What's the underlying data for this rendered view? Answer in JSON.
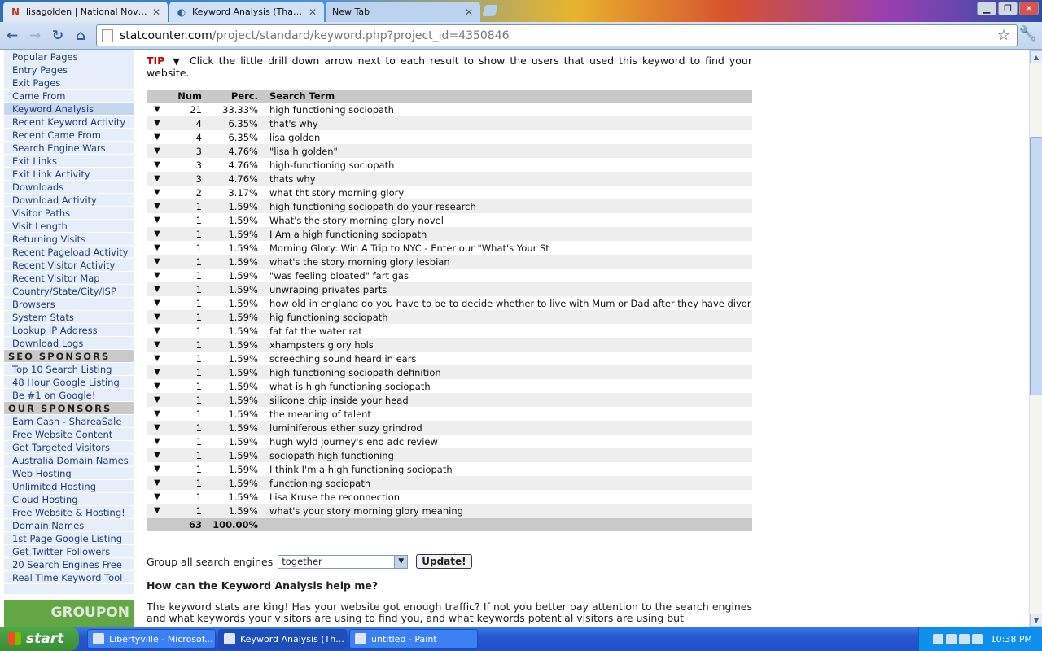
{
  "browser": {
    "tabs": [
      {
        "label": "lisagolden | National Novel ...",
        "icon": "N"
      },
      {
        "label": "Keyword Analysis (That's ...",
        "icon": "◐"
      },
      {
        "label": "New Tab",
        "icon": ""
      }
    ],
    "url_host": "statcounter.com",
    "url_path": "/project/standard/keyword.php?project_id=4350846"
  },
  "sidebar": {
    "items": [
      {
        "label": "Popular Pages",
        "type": "link"
      },
      {
        "label": "Entry Pages",
        "type": "link"
      },
      {
        "label": "Exit Pages",
        "type": "link"
      },
      {
        "label": "Came From",
        "type": "link"
      },
      {
        "label": "Keyword Analysis",
        "type": "link",
        "active": true
      },
      {
        "label": "Recent Keyword Activity",
        "type": "link"
      },
      {
        "label": "Recent Came From",
        "type": "link"
      },
      {
        "label": "Search Engine Wars",
        "type": "link"
      },
      {
        "label": "Exit Links",
        "type": "link"
      },
      {
        "label": "Exit Link Activity",
        "type": "link"
      },
      {
        "label": "Downloads",
        "type": "link"
      },
      {
        "label": "Download Activity",
        "type": "link"
      },
      {
        "label": "Visitor Paths",
        "type": "link"
      },
      {
        "label": "Visit Length",
        "type": "link"
      },
      {
        "label": "Returning Visits",
        "type": "link"
      },
      {
        "label": "Recent Pageload Activity",
        "type": "link"
      },
      {
        "label": "Recent Visitor Activity",
        "type": "link"
      },
      {
        "label": "Recent Visitor Map",
        "type": "link"
      },
      {
        "label": "Country/State/City/ISP",
        "type": "link"
      },
      {
        "label": "Browsers",
        "type": "link"
      },
      {
        "label": "System Stats",
        "type": "link"
      },
      {
        "label": "Lookup IP Address",
        "type": "link"
      },
      {
        "label": "Download Logs",
        "type": "link"
      },
      {
        "label": "SEO SPONSORS",
        "type": "heading"
      },
      {
        "label": "Top 10 Search Listing",
        "type": "link"
      },
      {
        "label": "48 Hour Google Listing",
        "type": "link"
      },
      {
        "label": "Be #1 on Google!",
        "type": "link"
      },
      {
        "label": "OUR SPONSORS",
        "type": "heading"
      },
      {
        "label": "Earn Cash - ShareaSale",
        "type": "link"
      },
      {
        "label": "Free Website Content",
        "type": "link"
      },
      {
        "label": "Get Targeted Visitors",
        "type": "link"
      },
      {
        "label": "Australia Domain Names",
        "type": "link"
      },
      {
        "label": "Web Hosting",
        "type": "link"
      },
      {
        "label": "Unlimited Hosting",
        "type": "link"
      },
      {
        "label": "Cloud Hosting",
        "type": "link"
      },
      {
        "label": "Free Website & Hosting!",
        "type": "link"
      },
      {
        "label": "Domain Names",
        "type": "link"
      },
      {
        "label": "1st Page Google Listing",
        "type": "link"
      },
      {
        "label": "Get Twitter Followers",
        "type": "link"
      },
      {
        "label": "20 Search Engines Free",
        "type": "link"
      },
      {
        "label": "Real Time Keyword Tool",
        "type": "link"
      }
    ],
    "banner": "GROUPON"
  },
  "main": {
    "tip_label": "TIP",
    "tip_text": "Click the little drill down arrow next to each result to show the users that used this keyword to find your website.",
    "table": {
      "headers": {
        "num": "Num",
        "perc": "Perc.",
        "term": "Search Term"
      },
      "rows": [
        {
          "num": "21",
          "perc": "33.33%",
          "term": "high functioning sociopath"
        },
        {
          "num": "4",
          "perc": "6.35%",
          "term": "that's why"
        },
        {
          "num": "4",
          "perc": "6.35%",
          "term": "lisa golden"
        },
        {
          "num": "3",
          "perc": "4.76%",
          "term": "\"lisa h golden\""
        },
        {
          "num": "3",
          "perc": "4.76%",
          "term": "high-functioning sociopath"
        },
        {
          "num": "3",
          "perc": "4.76%",
          "term": "thats why"
        },
        {
          "num": "2",
          "perc": "3.17%",
          "term": "what tht story morning glory"
        },
        {
          "num": "1",
          "perc": "1.59%",
          "term": "high functioning sociopath do your research"
        },
        {
          "num": "1",
          "perc": "1.59%",
          "term": "What's the story morning glory novel"
        },
        {
          "num": "1",
          "perc": "1.59%",
          "term": "I Am a high functioning sociopath"
        },
        {
          "num": "1",
          "perc": "1.59%",
          "term": "Morning Glory: Win A Trip to NYC - Enter our \"What's Your St"
        },
        {
          "num": "1",
          "perc": "1.59%",
          "term": "what's the story morning glory lesbian"
        },
        {
          "num": "1",
          "perc": "1.59%",
          "term": "\"was feeling bloated\" fart gas"
        },
        {
          "num": "1",
          "perc": "1.59%",
          "term": "unwraping privates parts"
        },
        {
          "num": "1",
          "perc": "1.59%",
          "term": "how old in england do you have to be to decide whether to live with Mum or Dad after they have divor"
        },
        {
          "num": "1",
          "perc": "1.59%",
          "term": "hig functioning sociopath"
        },
        {
          "num": "1",
          "perc": "1.59%",
          "term": "fat fat the water rat"
        },
        {
          "num": "1",
          "perc": "1.59%",
          "term": "xhampsters glory hols"
        },
        {
          "num": "1",
          "perc": "1.59%",
          "term": "screeching sound heard in ears"
        },
        {
          "num": "1",
          "perc": "1.59%",
          "term": "high functioning sociopath definition"
        },
        {
          "num": "1",
          "perc": "1.59%",
          "term": "what is high functioning sociopath"
        },
        {
          "num": "1",
          "perc": "1.59%",
          "term": "silicone chip inside your head"
        },
        {
          "num": "1",
          "perc": "1.59%",
          "term": "the meaning of talent"
        },
        {
          "num": "1",
          "perc": "1.59%",
          "term": "luminiferous ether suzy grindrod"
        },
        {
          "num": "1",
          "perc": "1.59%",
          "term": "hugh wyld journey's end adc review"
        },
        {
          "num": "1",
          "perc": "1.59%",
          "term": "sociopath high functioning"
        },
        {
          "num": "1",
          "perc": "1.59%",
          "term": "I think I'm a high functioning sociopath"
        },
        {
          "num": "1",
          "perc": "1.59%",
          "term": "functioning sociopath"
        },
        {
          "num": "1",
          "perc": "1.59%",
          "term": "Lisa Kruse the reconnection"
        },
        {
          "num": "1",
          "perc": "1.59%",
          "term": "what's your story morning glory meaning"
        }
      ],
      "total_num": "63",
      "total_perc": "100.00%"
    },
    "group_label": "Group all search engines",
    "group_value": "together",
    "update_label": "Update!",
    "help_heading": "How can the Keyword Analysis help me?",
    "help_text": "The keyword stats are king! Has your website got enough traffic? If not you better pay attention to the search engines and what keywords your visitors are using to find you, and what keywords potential visitors are using but"
  },
  "taskbar": {
    "start_label": "start",
    "tasks": [
      {
        "label": "Libertyville - Microsof..."
      },
      {
        "label": "Keyword Analysis (Th..."
      },
      {
        "label": "untitled - Paint"
      }
    ],
    "clock": "10:38 PM"
  }
}
